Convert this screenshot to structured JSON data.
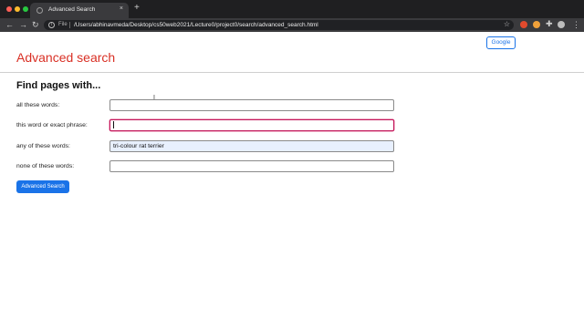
{
  "browser": {
    "tab_title": "Advanced Search",
    "tab_close": "×",
    "new_tab": "+",
    "nav_back": "←",
    "nav_forward": "→",
    "nav_reload": "↻",
    "info_icon": "i",
    "scheme_label": "File",
    "url": "/Users/abhinavmeda/Desktop/cs50web2021/Lecture0/project0/search/advanced_search.html",
    "star": "☆",
    "puzzle": "✚",
    "menu": "⋮"
  },
  "page": {
    "google_link": "Google",
    "title": "Advanced search",
    "subtitle": "Find pages with...",
    "fields": [
      {
        "label": "all these words:",
        "value": ""
      },
      {
        "label": "this word or exact phrase:",
        "value": ""
      },
      {
        "label": "any of these words:",
        "value": "tri-colour rat terrier"
      },
      {
        "label": "none of these words:",
        "value": ""
      }
    ],
    "submit_label": "Advanced Search"
  }
}
